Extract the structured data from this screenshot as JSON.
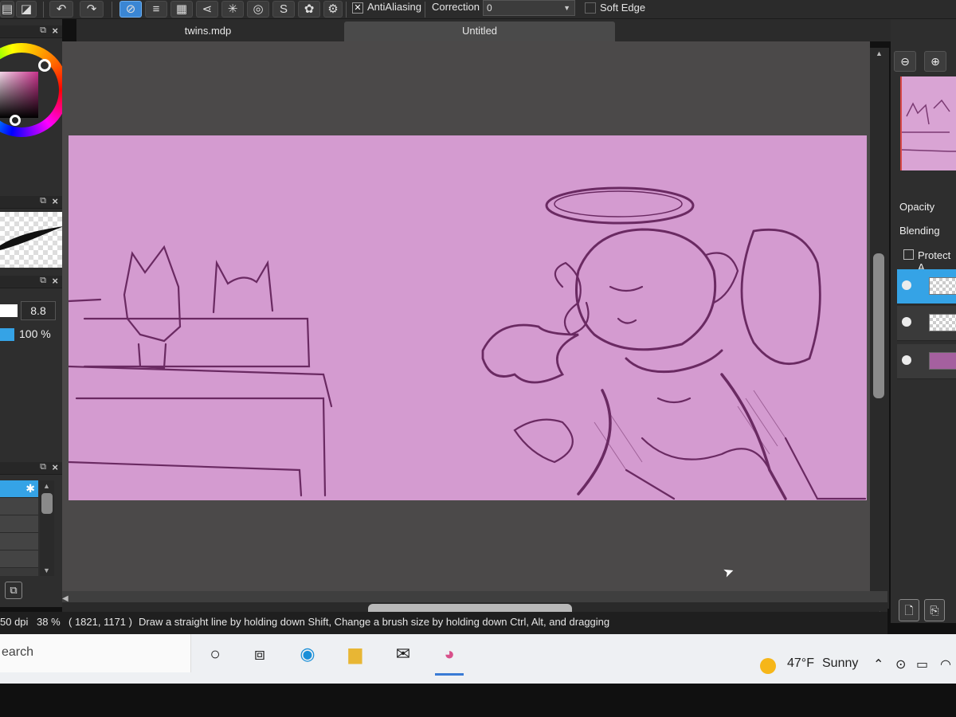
{
  "toolbar": {
    "tools": [
      {
        "icon": "undo-icon",
        "glyph": "↶"
      },
      {
        "icon": "redo-icon",
        "glyph": "↷"
      },
      {
        "icon": "snap-off-icon",
        "glyph": "⃠"
      },
      {
        "icon": "parallel-snap-icon",
        "glyph": "≡"
      },
      {
        "icon": "grid-snap-icon",
        "glyph": "▦"
      },
      {
        "icon": "perspective-snap-icon",
        "glyph": "⋖"
      },
      {
        "icon": "radial-snap-icon",
        "glyph": "✳"
      },
      {
        "icon": "concentric-snap-icon",
        "glyph": "◎"
      },
      {
        "icon": "curve-snap-icon",
        "glyph": "S"
      },
      {
        "icon": "symmetry-icon",
        "glyph": "✿"
      },
      {
        "icon": "settings-icon",
        "glyph": "⚙"
      }
    ],
    "antialiasing_label": "AntiAliasing",
    "antialiasing_checked": true,
    "correction_label": "Correction",
    "correction_value": "0",
    "soft_edge_label": "Soft Edge",
    "soft_edge_checked": false
  },
  "tabs": [
    {
      "label": "twins.mdp",
      "active": false
    },
    {
      "label": "Untitled",
      "active": true
    }
  ],
  "left_panel": {
    "brush_size": "8.8",
    "brush_opacity": "100 %",
    "accent_color": "#35a3e6"
  },
  "right_panel": {
    "opacity_label": "Opacity",
    "blending_label": "Blending",
    "protect_label": "Protect A"
  },
  "status": {
    "dpi": "50 dpi",
    "zoom": "38 %",
    "coords": "( 1821, 1171 )",
    "hint": "Draw a straight line by holding down Shift, Change a brush size by holding down Ctrl, Alt, and dragging"
  },
  "taskbar": {
    "search_text": "earch",
    "weather_temp": "47°F",
    "weather_desc": "Sunny"
  },
  "canvas": {
    "background_color": "#d49bd0",
    "line_color": "#6a2a62"
  }
}
